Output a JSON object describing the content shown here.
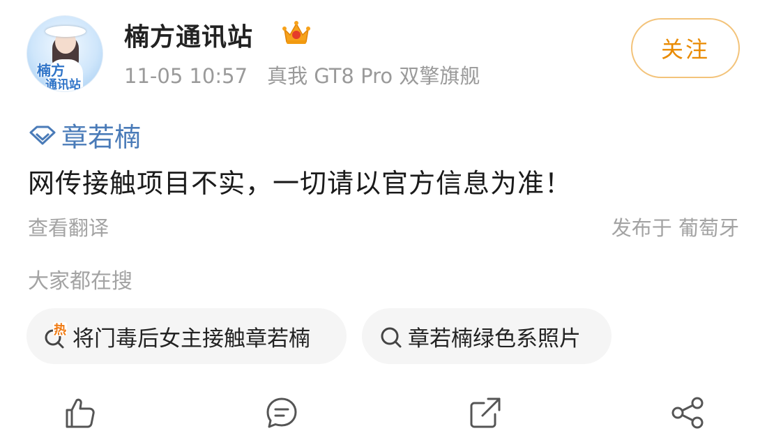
{
  "post": {
    "author": "楠方通讯站",
    "avatar_text_line1": "楠方",
    "avatar_text_line2": "通讯站",
    "time": "11-05 10:57",
    "device": "真我 GT8 Pro 双擎旗舰",
    "follow_label": "关注",
    "topic": "章若楠",
    "content": "网传接触项目不实，一切请以官方信息为准！",
    "translate_label": "查看翻译",
    "location": "发布于 葡萄牙"
  },
  "search": {
    "title": "大家都在搜",
    "items": [
      {
        "label": "将门毒后女主接触章若楠",
        "hot_badge": "热"
      },
      {
        "label": "章若楠绿色系照片"
      }
    ]
  },
  "actions": [
    "like-icon",
    "comment-icon",
    "repost-icon",
    "share-icon"
  ],
  "colors": {
    "follow": "#e98a00",
    "topic": "#4a7bb8",
    "hot": "#f07a12"
  }
}
